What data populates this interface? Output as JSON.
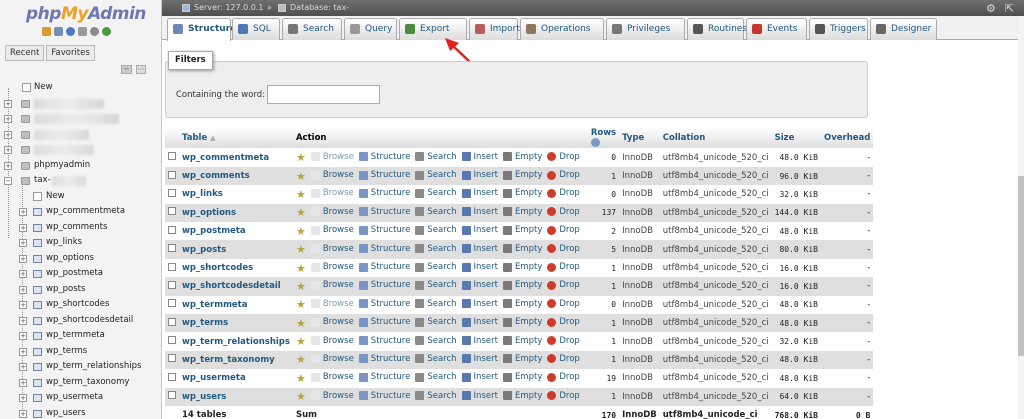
{
  "logo": {
    "php": "php",
    "my": "My",
    "admin": "Admin"
  },
  "nav": {
    "tabs": [
      "Recent",
      "Favorites"
    ],
    "tree_new": "New",
    "db_phpmyadmin": "phpmyadmin",
    "db_tax": "tax-",
    "tax_new": "New",
    "tables": [
      "wp_commentmeta",
      "wp_comments",
      "wp_links",
      "wp_options",
      "wp_postmeta",
      "wp_posts",
      "wp_shortcodes",
      "wp_shortcodesdetail",
      "wp_termmeta",
      "wp_terms",
      "wp_term_relationships",
      "wp_term_taxonomy",
      "wp_usermeta",
      "wp_users"
    ]
  },
  "topbar": {
    "server": "Server: 127.0.0.1",
    "sep": "»",
    "database": "Database: tax-"
  },
  "menu": [
    {
      "label": "Structure",
      "icon": "structure-icon",
      "color": "#6c87b8"
    },
    {
      "label": "SQL",
      "icon": "sql-icon",
      "color": "#4a79b6"
    },
    {
      "label": "Search",
      "icon": "search-icon",
      "color": "#777"
    },
    {
      "label": "Query",
      "icon": "query-icon",
      "color": "#999"
    },
    {
      "label": "Export",
      "icon": "export-icon",
      "color": "#4b8a3e"
    },
    {
      "label": "Import",
      "icon": "import-icon",
      "color": "#b85b5b"
    },
    {
      "label": "Operations",
      "icon": "operations-icon",
      "color": "#8a7a5a"
    },
    {
      "label": "Privileges",
      "icon": "privileges-icon",
      "color": "#777"
    },
    {
      "label": "Routines",
      "icon": "routines-icon",
      "color": "#555"
    },
    {
      "label": "Events",
      "icon": "events-icon",
      "color": "#c0392b"
    },
    {
      "label": "Triggers",
      "icon": "triggers-icon",
      "color": "#555"
    },
    {
      "label": "Designer",
      "icon": "designer-icon",
      "color": "#666"
    }
  ],
  "filters": {
    "legend": "Filters",
    "label": "Containing the word:",
    "value": ""
  },
  "table": {
    "headers": {
      "table": "Table",
      "action": "Action",
      "rows": "Rows",
      "type": "Type",
      "collation": "Collation",
      "size": "Size",
      "overhead": "Overhead"
    },
    "actions": {
      "browse": "Browse",
      "structure": "Structure",
      "search": "Search",
      "insert": "Insert",
      "empty": "Empty",
      "drop": "Drop"
    },
    "rows": [
      {
        "name": "wp_commentmeta",
        "rows": "0",
        "type": "InnoDB",
        "collation": "utf8mb4_unicode_520_ci",
        "size": "48.0 KiB",
        "overhead": "-"
      },
      {
        "name": "wp_comments",
        "rows": "1",
        "type": "InnoDB",
        "collation": "utf8mb4_unicode_520_ci",
        "size": "96.0 KiB",
        "overhead": "-"
      },
      {
        "name": "wp_links",
        "rows": "0",
        "type": "InnoDB",
        "collation": "utf8mb4_unicode_520_ci",
        "size": "32.0 KiB",
        "overhead": "-"
      },
      {
        "name": "wp_options",
        "rows": "137",
        "type": "InnoDB",
        "collation": "utf8mb4_unicode_520_ci",
        "size": "144.0 KiB",
        "overhead": "-"
      },
      {
        "name": "wp_postmeta",
        "rows": "2",
        "type": "InnoDB",
        "collation": "utf8mb4_unicode_520_ci",
        "size": "48.0 KiB",
        "overhead": "-"
      },
      {
        "name": "wp_posts",
        "rows": "5",
        "type": "InnoDB",
        "collation": "utf8mb4_unicode_520_ci",
        "size": "80.0 KiB",
        "overhead": "-"
      },
      {
        "name": "wp_shortcodes",
        "rows": "1",
        "type": "InnoDB",
        "collation": "utf8mb4_unicode_520_ci",
        "size": "16.0 KiB",
        "overhead": "-"
      },
      {
        "name": "wp_shortcodesdetail",
        "rows": "1",
        "type": "InnoDB",
        "collation": "utf8mb4_unicode_520_ci",
        "size": "16.0 KiB",
        "overhead": "-"
      },
      {
        "name": "wp_termmeta",
        "rows": "0",
        "type": "InnoDB",
        "collation": "utf8mb4_unicode_520_ci",
        "size": "48.0 KiB",
        "overhead": "-"
      },
      {
        "name": "wp_terms",
        "rows": "1",
        "type": "InnoDB",
        "collation": "utf8mb4_unicode_520_ci",
        "size": "48.0 KiB",
        "overhead": "-"
      },
      {
        "name": "wp_term_relationships",
        "rows": "1",
        "type": "InnoDB",
        "collation": "utf8mb4_unicode_520_ci",
        "size": "32.0 KiB",
        "overhead": "-"
      },
      {
        "name": "wp_term_taxonomy",
        "rows": "1",
        "type": "InnoDB",
        "collation": "utf8mb4_unicode_520_ci",
        "size": "48.0 KiB",
        "overhead": "-"
      },
      {
        "name": "wp_usermeta",
        "rows": "19",
        "type": "InnoDB",
        "collation": "utf8mb4_unicode_520_ci",
        "size": "48.0 KiB",
        "overhead": "-"
      },
      {
        "name": "wp_users",
        "rows": "1",
        "type": "InnoDB",
        "collation": "utf8mb4_unicode_520_ci",
        "size": "64.0 KiB",
        "overhead": "-"
      }
    ],
    "footer": {
      "count": "14 tables",
      "sum": "Sum",
      "rows": "170",
      "type": "InnoDB",
      "collation": "utf8mb4_unicode_ci",
      "size": "768.0 KiB",
      "overhead": "0 B"
    }
  },
  "colors": {
    "link": "#235a81",
    "arrow": "#e02020",
    "row_alt": "#dfdfdf"
  }
}
